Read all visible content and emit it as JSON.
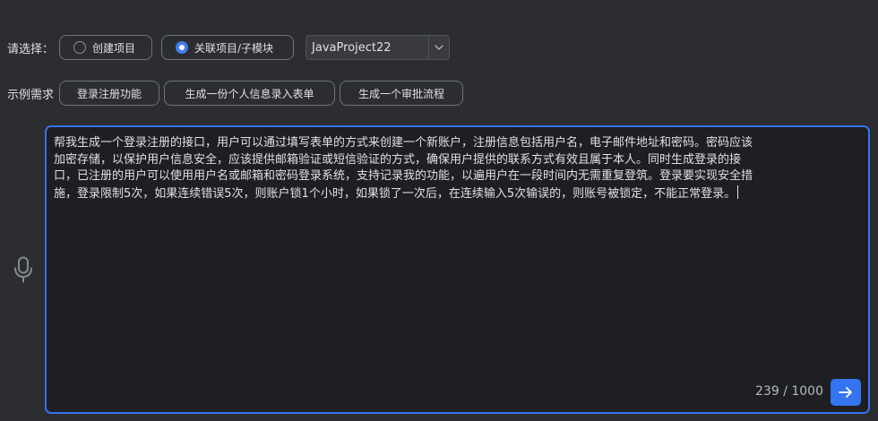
{
  "selection_row": {
    "label": "请选择：",
    "options": [
      {
        "label": "创建项目",
        "checked": false
      },
      {
        "label": "关联项目/子模块",
        "checked": true
      }
    ],
    "project_select": {
      "value": "JavaProject22",
      "icon": "chevron-down-icon"
    }
  },
  "examples_row": {
    "label": "示例需求",
    "items": [
      {
        "label": "登录注册功能"
      },
      {
        "label": "生成一份个人信息录入表单"
      },
      {
        "label": "生成一个审批流程"
      }
    ]
  },
  "mic": {
    "icon": "microphone-icon"
  },
  "editor": {
    "text": "帮我生成一个登录注册的接口，用户可以通过填写表单的方式来创建一个新账户，注册信息包括用户名，电子邮件地址和密码。密码应该加密存储，以保护用户信息安全，应该提供邮箱验证或短信验证的方式，确保用户提供的联系方式有效且属于本人。同时生成登录的接口，已注册的用户可以使用用户名或邮箱和密码登录系统，支持记录我的功能，以遍用户在一段时间内无需重复登筑。登录要实现安全措施，登录限制5次，如果连续错误5次，则账户锁1个小时，如果锁了一次后，在连续输入5次输误的，则账号被锁定，不能正常登录。",
    "counter": "239 / 1000",
    "send_icon": "arrow-right-icon"
  },
  "colors": {
    "background": "#2b2d30",
    "editor_background": "#1e1f22",
    "accent": "#3574f0",
    "radio_checked": "#3f7df0",
    "text": "#dfe1e5"
  }
}
